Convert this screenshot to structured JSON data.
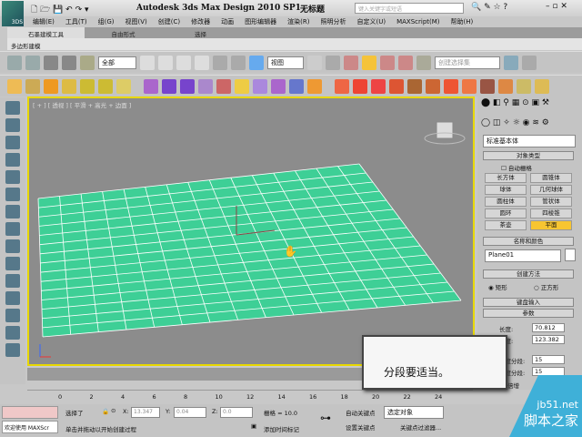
{
  "app": {
    "title": "Autodesk 3ds Max Design 2010 SP1",
    "document": "无标题",
    "search_placeholder": "键入关键字或短语",
    "logo_text": "3DS"
  },
  "menu": [
    "编辑(E)",
    "工具(T)",
    "组(G)",
    "视图(V)",
    "创建(C)",
    "修改器",
    "动画",
    "图形编辑器",
    "渲染(R)",
    "照明分析",
    "自定义(U)",
    "MAXScript(M)",
    "帮助(H)"
  ],
  "ribbon": {
    "tabs": [
      "石墨建模工具",
      "自由形式",
      "选择"
    ],
    "subtab": "多边形建模"
  },
  "toolbar": {
    "selection_filter": "全部",
    "ref_coord": "视图",
    "named_selection": "创建选择集"
  },
  "viewport": {
    "label": "[ + ] [ 透视 ] [ 平滑 + 高光 + 边面 ]",
    "plane_color": "#3ecf96",
    "segments": 15
  },
  "panel": {
    "category": "标准基本体",
    "object_type": {
      "title": "对象类型",
      "autogrid": "自动栅格",
      "buttons": [
        "长方体",
        "圆锥体",
        "球体",
        "几何球体",
        "圆柱体",
        "管状体",
        "圆环",
        "四棱锥",
        "茶壶",
        "平面"
      ],
      "active": "平面"
    },
    "name_color": {
      "title": "名称和颜色",
      "name": "Plane01"
    },
    "creation_method": {
      "title": "创建方法",
      "options": [
        "矩形",
        "正方形"
      ],
      "selected": "矩形"
    },
    "keyboard_entry": "键盘输入",
    "params": {
      "title": "参数",
      "length_label": "长度:",
      "length": "70.812",
      "width_label": "宽度:",
      "width": "123.382",
      "len_segs_label": "长度分段:",
      "len_segs": "15",
      "wid_segs_label": "宽度分段:",
      "wid_segs": "15",
      "render_scale": "渲染倍增"
    }
  },
  "timeline": {
    "ticks": [
      "0",
      "2",
      "4",
      "6",
      "8",
      "10",
      "12",
      "14",
      "16",
      "18",
      "20",
      "22",
      "24"
    ]
  },
  "status": {
    "welcome": "欢迎使用 MAXScr",
    "selected": "选择了",
    "x_label": "X:",
    "x": "13.347",
    "y_label": "Y:",
    "y": "0.04",
    "z_label": "Z:",
    "z": "0.0",
    "grid": "栅格 = 10.0",
    "prompt": "单击并拖动以开始创建过程",
    "add_time_tag": "添加时间标记",
    "auto_key": "自动关键点",
    "set_key": "设置关键点",
    "key_filter_sel": "选定对象",
    "key_filters": "关键点过滤器..."
  },
  "tooltip": "分段要适当。",
  "watermark": {
    "url": "jb51.net",
    "name": "脚本之家"
  }
}
